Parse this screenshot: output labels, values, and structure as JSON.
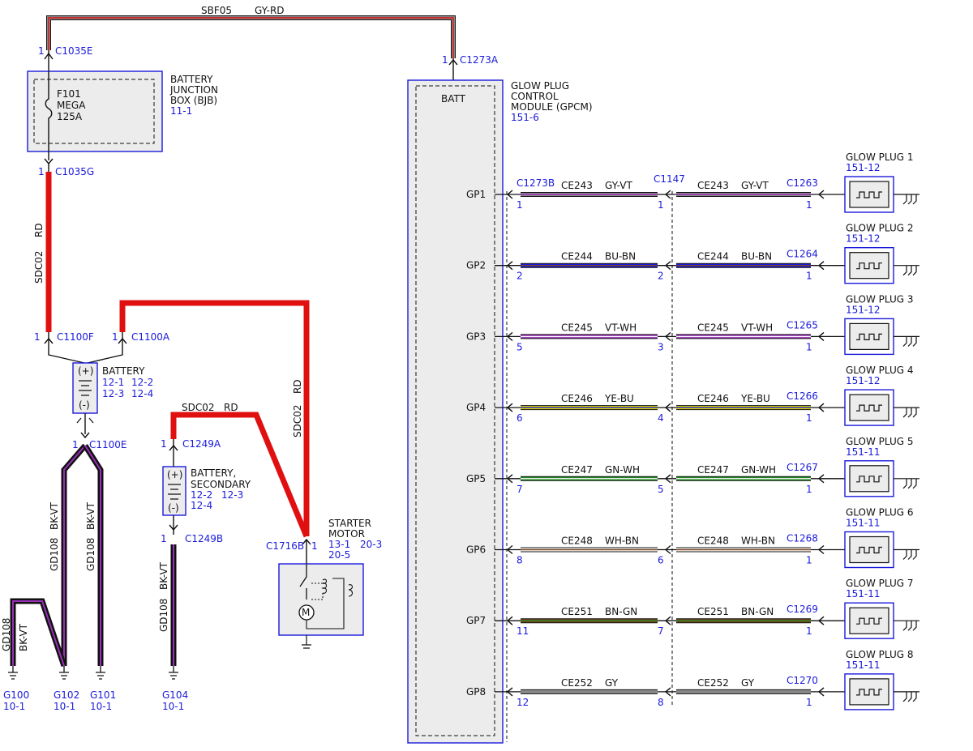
{
  "colors": {
    "red": "#e01010",
    "gy": "#8a8a8a",
    "vt": "#9a2fb8",
    "bu": "#1a1adb",
    "bn": "#7a4520",
    "gn": "#1e8a1e",
    "ye": "#e8e000",
    "wh": "#ffffff",
    "bk": "#111111",
    "ref_blue": "#1a1adb",
    "module_fill": "#ececec"
  },
  "top_wire": {
    "circuit": "SBF05",
    "color": "GY-RD"
  },
  "bjb": {
    "top_pin": "1",
    "top_conn": "C1035E",
    "bottom_pin": "1",
    "bottom_conn": "C1035G",
    "name_lines": [
      "BATTERY",
      "JUNCTION",
      "BOX (BJB)"
    ],
    "ref": "11-1",
    "fuse_lines": [
      "F101",
      "MEGA",
      "125A"
    ]
  },
  "sdc02_main": {
    "circuit": "SDC02",
    "color": "RD"
  },
  "battery": {
    "left_pin": "1",
    "left_conn": "C1100F",
    "right_pin": "1",
    "right_conn": "C1100A",
    "name": "BATTERY",
    "refs": [
      "12-1",
      "12-2",
      "12-3",
      "12-4"
    ],
    "plus": "(+)",
    "minus": "(-)",
    "ground_pin": "1",
    "ground_conn": "C1100E"
  },
  "battery_wire_to_starter": {
    "circuit": "SDC02",
    "color": "RD"
  },
  "secondary_battery": {
    "top_pin": "1",
    "top_conn": "C1249A",
    "bottom_pin": "1",
    "bottom_conn": "C1249B",
    "name_lines": [
      "BATTERY,",
      "SECONDARY"
    ],
    "refs": [
      "12-2",
      "12-3",
      "12-4"
    ],
    "plus": "(+)",
    "minus": "(-)",
    "feed_circuit": "SDC02",
    "feed_color": "RD",
    "ground_circuit": "GD108",
    "ground_color": "BK-VT"
  },
  "grounds_left": [
    {
      "circuit": "GD108",
      "color": "BK-VT"
    },
    {
      "circuit": "GD108",
      "color": "BK-VT"
    },
    {
      "circuit": "GD108",
      "color": "BK-VT"
    }
  ],
  "ground_points": [
    {
      "name": "G100",
      "ref": "10-1"
    },
    {
      "name": "G102",
      "ref": "10-1"
    },
    {
      "name": "G101",
      "ref": "10-1"
    },
    {
      "name": "G104",
      "ref": "10-1"
    }
  ],
  "starter": {
    "conn": "C1716B",
    "pin": "1",
    "name_lines": [
      "STARTER",
      "MOTOR"
    ],
    "refs": [
      "13-1",
      "20-3",
      "20-5"
    ]
  },
  "gpcm": {
    "pin": "1",
    "conn": "C1273A",
    "batt_label": "BATT",
    "name_lines": [
      "GLOW PLUG",
      "CONTROL",
      "MODULE (GPCM)"
    ],
    "ref": "151-6",
    "conn_out": "C1273B",
    "inline_conn": "C1147"
  },
  "glow_plugs": [
    {
      "gp": "GP1",
      "circuit": "CE243",
      "color": "GY-VT",
      "pin_a": "1",
      "pin_b": "1",
      "plug_conn": "C1263",
      "plug_pin": "1",
      "name": "GLOW PLUG 1",
      "ref": "151-12",
      "base": "gy",
      "stripe": "vt"
    },
    {
      "gp": "GP2",
      "circuit": "CE244",
      "color": "BU-BN",
      "pin_a": "2",
      "pin_b": "2",
      "plug_conn": "C1264",
      "plug_pin": "1",
      "name": "GLOW PLUG 2",
      "ref": "151-12",
      "base": "bu",
      "stripe": "bn"
    },
    {
      "gp": "GP3",
      "circuit": "CE245",
      "color": "VT-WH",
      "pin_a": "5",
      "pin_b": "3",
      "plug_conn": "C1265",
      "plug_pin": "1",
      "name": "GLOW PLUG 3",
      "ref": "151-12",
      "base": "vt",
      "stripe": "wh"
    },
    {
      "gp": "GP4",
      "circuit": "CE246",
      "color": "YE-BU",
      "pin_a": "6",
      "pin_b": "4",
      "plug_conn": "C1266",
      "plug_pin": "1",
      "name": "GLOW PLUG 4",
      "ref": "151-12",
      "base": "ye",
      "stripe": "bu"
    },
    {
      "gp": "GP5",
      "circuit": "CE247",
      "color": "GN-WH",
      "pin_a": "7",
      "pin_b": "5",
      "plug_conn": "C1267",
      "plug_pin": "1",
      "name": "GLOW PLUG 5",
      "ref": "151-11",
      "base": "gn",
      "stripe": "wh"
    },
    {
      "gp": "GP6",
      "circuit": "CE248",
      "color": "WH-BN",
      "pin_a": "8",
      "pin_b": "6",
      "plug_conn": "C1268",
      "plug_pin": "1",
      "name": "GLOW PLUG 6",
      "ref": "151-11",
      "base": "wh",
      "stripe": "bn"
    },
    {
      "gp": "GP7",
      "circuit": "CE251",
      "color": "BN-GN",
      "pin_a": "11",
      "pin_b": "7",
      "plug_conn": "C1269",
      "plug_pin": "1",
      "name": "GLOW PLUG 7",
      "ref": "151-11",
      "base": "bn",
      "stripe": "gn"
    },
    {
      "gp": "GP8",
      "circuit": "CE252",
      "color": "GY",
      "pin_a": "12",
      "pin_b": "8",
      "plug_conn": "C1270",
      "plug_pin": "1",
      "name": "GLOW PLUG 8",
      "ref": "151-11",
      "base": "gy",
      "stripe": "gy"
    }
  ]
}
